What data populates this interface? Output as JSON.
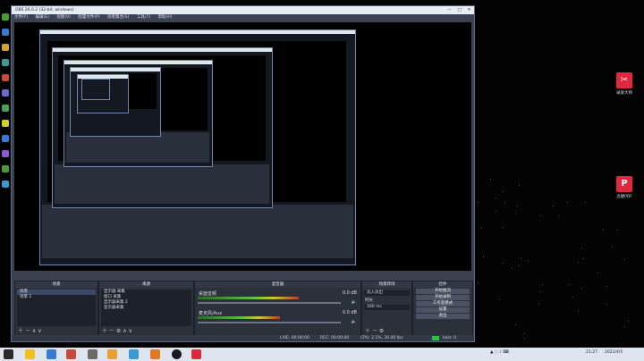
{
  "obs": {
    "title": "OBS 26.0.2 (32-bit, windows)",
    "menu": [
      "文件(F)",
      "编辑(E)",
      "视图(V)",
      "配置文件(P)",
      "场景集合(S)",
      "工具(T)",
      "帮助(H)"
    ],
    "docks": {
      "scenes": {
        "title": "场景",
        "items": [
          "场景",
          "场景 2"
        ]
      },
      "sources": {
        "title": "来源",
        "items": [
          "显示器 采集",
          "窗口 采集",
          "显示器采集 2",
          "显示器采集"
        ]
      },
      "mixer": {
        "title": "混音器",
        "channels": [
          {
            "name": "桌面音频",
            "db": "0.0 dB",
            "level": 0.62
          },
          {
            "name": "麦克风/Aux",
            "db": "0.0 dB",
            "level": 0.48
          }
        ]
      },
      "transitions": {
        "title": "场景转场",
        "value": "淡入淡出",
        "duration_label": "时长",
        "duration": "300 ms"
      },
      "controls": {
        "title": "控件",
        "buttons": [
          "开始推流",
          "开始录制",
          "工作室模式",
          "设置",
          "退出"
        ]
      }
    },
    "status": {
      "live": "LIVE: 00:00:00",
      "rec": "REC: 00:00:00",
      "cpu": "CPU: 2.1%, 30.00 fps",
      "kbps": "kb/s: 0"
    }
  },
  "desktop_icons": [
    {
      "id": "app1",
      "label": "录屏大师",
      "glyph": "✂"
    },
    {
      "id": "app2",
      "label": "迅捷PDF",
      "glyph": "P"
    }
  ],
  "taskbar": {
    "time": "21:27",
    "date": "2021/4/5"
  },
  "colors": {
    "obs_window_bg": "#3a4150",
    "desktop_bg": "#030303",
    "meter_green": "#5cc23e",
    "accent_red": "#e1273b"
  }
}
